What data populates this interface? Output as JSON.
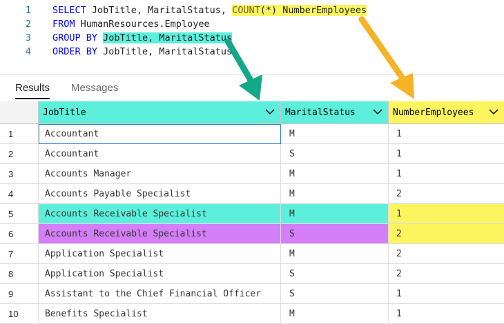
{
  "editor": {
    "lines": [
      {
        "num": "1",
        "parts": [
          {
            "text": "SELECT ",
            "cls": "kw"
          },
          {
            "text": "JobTitle, MaritalStatus, ",
            "cls": ""
          },
          {
            "text": "COUNT",
            "cls": "fn hl-y"
          },
          {
            "text": "(*) NumberEmployees",
            "cls": "hl-y"
          }
        ]
      },
      {
        "num": "2",
        "parts": [
          {
            "text": "FROM ",
            "cls": "kw"
          },
          {
            "text": "HumanResources.Employee",
            "cls": ""
          }
        ]
      },
      {
        "num": "3",
        "parts": [
          {
            "text": "GROUP BY ",
            "cls": "kw"
          },
          {
            "text": "JobTitle, MaritalStatus",
            "cls": "hl-t"
          }
        ]
      },
      {
        "num": "4",
        "parts": [
          {
            "text": "ORDER BY ",
            "cls": "kw"
          },
          {
            "text": "JobTitle, MaritalStatus",
            "cls": ""
          }
        ]
      }
    ]
  },
  "tabs": {
    "results": "Results",
    "messages": "Messages"
  },
  "colors": {
    "teal": "#5cf0dc",
    "yellow": "#fcf55f",
    "purple": "#d47ff7",
    "arrow_green": "#13a88a",
    "arrow_orange": "#f5b325",
    "header_bg": "#f3f3f3"
  },
  "grid": {
    "columns": [
      "JobTitle",
      "MaritalStatus",
      "NumberEmployees"
    ],
    "chevron": "chevron-down-icon",
    "rows": [
      {
        "n": "1",
        "job": "Accountant",
        "status": "M",
        "count": "1"
      },
      {
        "n": "2",
        "job": "Accountant",
        "status": "S",
        "count": "1"
      },
      {
        "n": "3",
        "job": "Accounts Manager",
        "status": "M",
        "count": "1"
      },
      {
        "n": "4",
        "job": "Accounts Payable Specialist",
        "status": "M",
        "count": "2"
      },
      {
        "n": "5",
        "job": "Accounts Receivable Specialist",
        "status": "M",
        "count": "1"
      },
      {
        "n": "6",
        "job": "Accounts Receivable Specialist",
        "status": "S",
        "count": "2"
      },
      {
        "n": "7",
        "job": "Application Specialist",
        "status": "M",
        "count": "2"
      },
      {
        "n": "8",
        "job": "Application Specialist",
        "status": "S",
        "count": "2"
      },
      {
        "n": "9",
        "job": "Assistant to the Chief Financial Officer",
        "status": "S",
        "count": "1"
      },
      {
        "n": "10",
        "job": "Benefits Specialist",
        "status": "M",
        "count": "1"
      }
    ]
  }
}
